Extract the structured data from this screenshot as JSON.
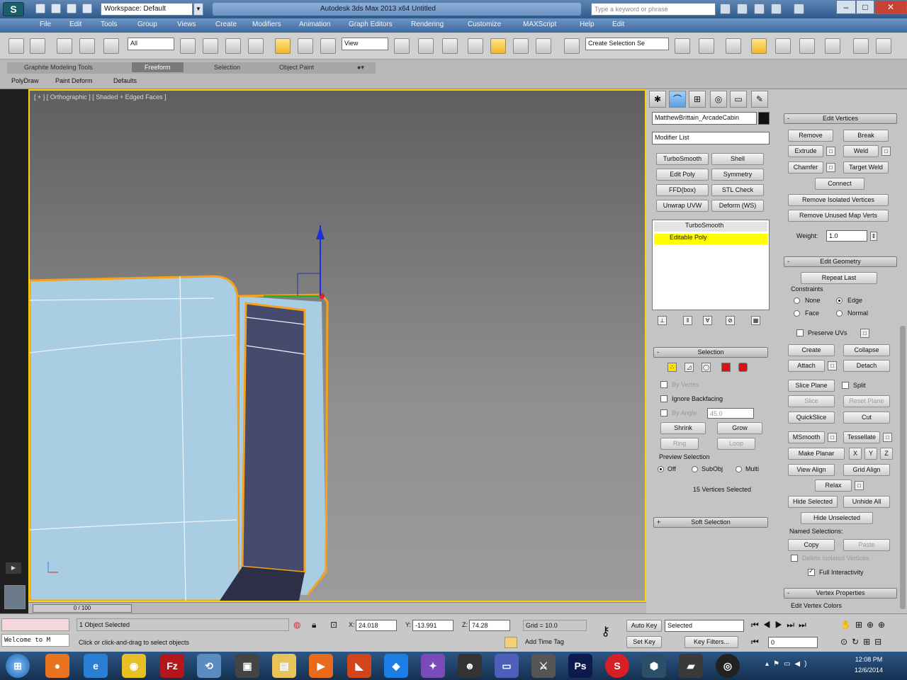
{
  "titlebar": {
    "app_icon": "S",
    "workspace": "Workspace: Default",
    "title": "Autodesk 3ds Max 2013 x64      Untitled",
    "search_placeholder": "Type a keyword or phrase"
  },
  "menu": [
    "File",
    "Edit",
    "Tools",
    "Group",
    "Views",
    "Create",
    "Modifiers",
    "Animation",
    "Graph Editors",
    "Rendering",
    "Customize",
    "MAXScript",
    "Help",
    "Edit"
  ],
  "toolbar": {
    "filter": "All",
    "ref_coord": "View",
    "named_selection": "Create Selection Se"
  },
  "ribbon": {
    "tabs": [
      "Graphite Modeling Tools",
      "Freeform",
      "Selection",
      "Object Paint"
    ],
    "links": [
      "PolyDraw",
      "Paint Deform",
      "Defaults"
    ]
  },
  "viewport": {
    "label": "[ + ] [ Orthographic ] [ Shaded + Edged Faces ]"
  },
  "command_panel": {
    "object_name": "MatthewBrittain_ArcadeCabin",
    "modifier_list": "Modifier List",
    "modifier_buttons": [
      [
        "TurboSmooth",
        "Shell"
      ],
      [
        "Edit Poly",
        "Symmetry"
      ],
      [
        "FFD(box)",
        "STL Check"
      ],
      [
        "Unwrap UVW",
        "Deform (WS)"
      ]
    ],
    "stack": [
      {
        "label": "TurboSmooth",
        "selected": false
      },
      {
        "label": "Editable Poly",
        "selected": true
      }
    ],
    "selection": {
      "title": "Selection",
      "by_vertex": "By Vertex",
      "ignore_backfacing": "Ignore Backfacing",
      "by_angle": "By Angle:",
      "angle_value": "45.0",
      "shrink": "Shrink",
      "grow": "Grow",
      "ring": "Ring",
      "loop": "Loop",
      "preview": "Preview Selection",
      "preview_options": [
        "Off",
        "SubObj",
        "Multi"
      ],
      "status": "15 Vertices Selected"
    },
    "soft_selection": "Soft Selection",
    "edit_vertices": {
      "title": "Edit Vertices",
      "rows": [
        [
          "Remove",
          "Break"
        ],
        [
          "Extrude",
          "Weld"
        ],
        [
          "Chamfer",
          "Target Weld"
        ]
      ],
      "connect": "Connect",
      "remove_isolated": "Remove Isolated Vertices",
      "remove_unused": "Remove Unused Map Verts",
      "weight_label": "Weight:",
      "weight_value": "1.0"
    },
    "edit_geometry": {
      "title": "Edit Geometry",
      "repeat_last": "Repeat Last",
      "constraints": "Constraints",
      "constraint_options": [
        "None",
        "Edge",
        "Face",
        "Normal"
      ],
      "preserve_uvs": "Preserve UVs",
      "create": "Create",
      "collapse": "Collapse",
      "attach": "Attach",
      "detach": "Detach",
      "slice_plane": "Slice Plane",
      "split": "Split",
      "slice": "Slice",
      "reset_plane": "Reset Plane",
      "quickslice": "QuickSlice",
      "cut": "Cut",
      "msmooth": "MSmooth",
      "tessellate": "Tessellate",
      "make_planar": "Make Planar",
      "xyz": [
        "X",
        "Y",
        "Z"
      ],
      "view_align": "View Align",
      "grid_align": "Grid Align",
      "relax": "Relax",
      "hide_selected": "Hide Selected",
      "unhide_all": "Unhide All",
      "hide_unselected": "Hide Unselected",
      "named_selections": "Named Selections:",
      "copy": "Copy",
      "paste": "Paste",
      "delete_isolated": "Delete Isolated Vertices",
      "full_interactivity": "Full Interactivity"
    },
    "vertex_properties": {
      "title": "Vertex Properties",
      "edit_colors": "Edit Vertex Colors"
    }
  },
  "trackbar": {
    "frame": "0 / 100"
  },
  "status": {
    "selected": "1 Object Selected",
    "prompt": "Click or click-and-drag to select objects",
    "listener": "Welcome to M",
    "x": "24.018",
    "y": "-13.991",
    "z": "74.28",
    "grid": "Grid = 10.0",
    "add_time_tag": "Add Time Tag",
    "auto_key": "Auto Key",
    "set_key": "Set Key",
    "key_mode": "Selected",
    "key_filters": "Key Filters...",
    "frame": "0"
  },
  "taskbar": {
    "time": "12:08 PM",
    "date": "12/6/2014"
  },
  "colors": {
    "viewport_border": "#ffd400",
    "selected_modifier": "#ffff00",
    "mesh": "#a9cde2",
    "selected_face": "#464a6c",
    "selection_outline": "#f5a11a"
  }
}
